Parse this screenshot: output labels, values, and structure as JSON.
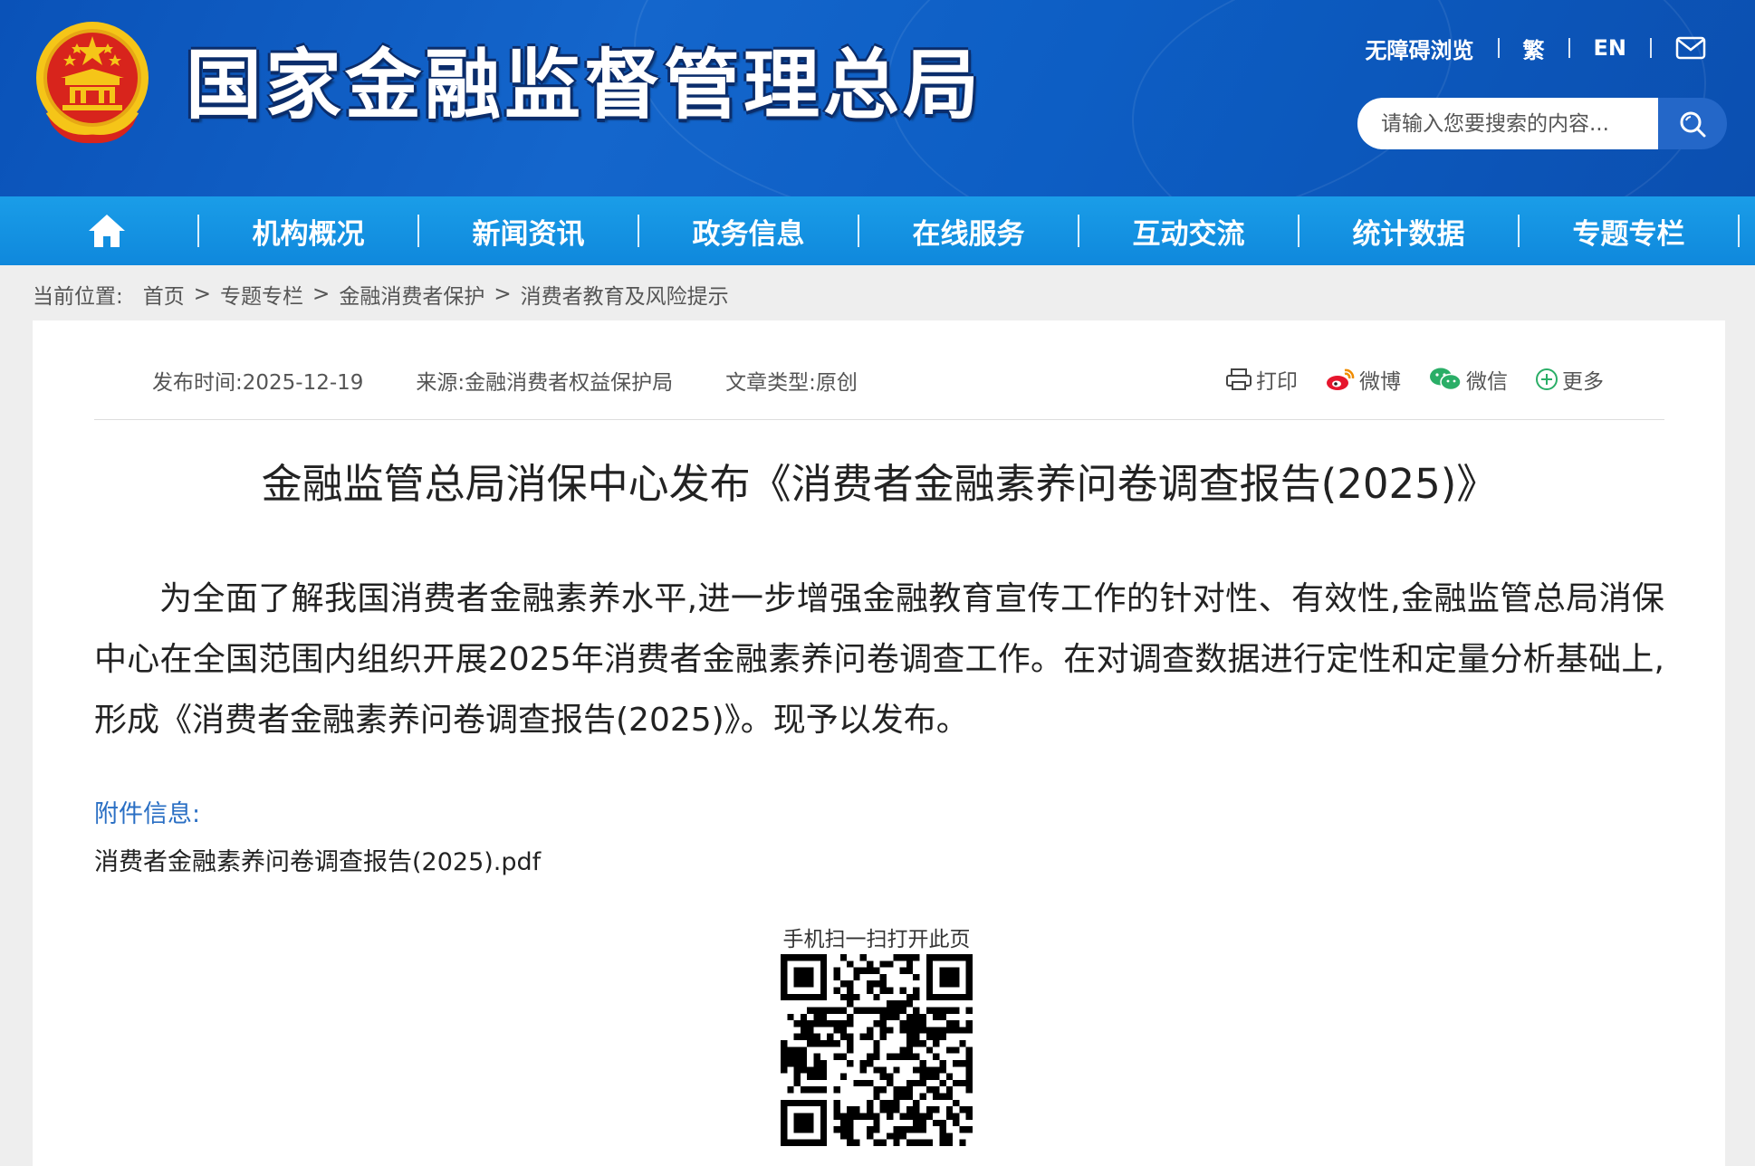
{
  "header": {
    "site_title": "国家金融监督管理总局",
    "links": {
      "accessibility": "无障碍浏览",
      "traditional": "繁",
      "english": "EN"
    },
    "search": {
      "placeholder": "请输入您要搜索的内容..."
    }
  },
  "nav": {
    "items": [
      "机构概况",
      "新闻资讯",
      "政务信息",
      "在线服务",
      "互动交流",
      "统计数据",
      "专题专栏"
    ]
  },
  "breadcrumb": {
    "label": "当前位置:",
    "items": [
      "首页",
      "专题专栏",
      "金融消费者保护",
      "消费者教育及风险提示"
    ],
    "separator": ">"
  },
  "article": {
    "meta": {
      "publish_time": "发布时间:2025-12-19",
      "source": "来源:金融消费者权益保护局",
      "type": "文章类型:原创"
    },
    "share": {
      "print": "打印",
      "weibo": "微博",
      "wechat": "微信",
      "more": "更多"
    },
    "title": "金融监管总局消保中心发布《消费者金融素养问卷调查报告(2025)》",
    "body": "为全面了解我国消费者金融素养水平,进一步增强金融教育宣传工作的针对性、有效性,金融监管总局消保中心在全国范围内组织开展2025年消费者金融素养问卷调查工作。在对调查数据进行定性和定量分析基础上,形成《消费者金融素养问卷调查报告(2025)》。现予以发布。",
    "attachment_label": "附件信息:",
    "attachment_file": "消费者金融素养问卷调查报告(2025).pdf",
    "qr_caption": "手机扫一扫打开此页"
  },
  "colors": {
    "header_blue": "#0d5ec4",
    "nav_blue": "#1494e0",
    "link_blue": "#2a6fc4",
    "emblem_red": "#d8241c",
    "emblem_gold": "#f5c518"
  },
  "icons": [
    "home-icon",
    "mail-icon",
    "search-icon",
    "print-icon",
    "weibo-icon",
    "wechat-icon",
    "plus-circle-icon"
  ]
}
